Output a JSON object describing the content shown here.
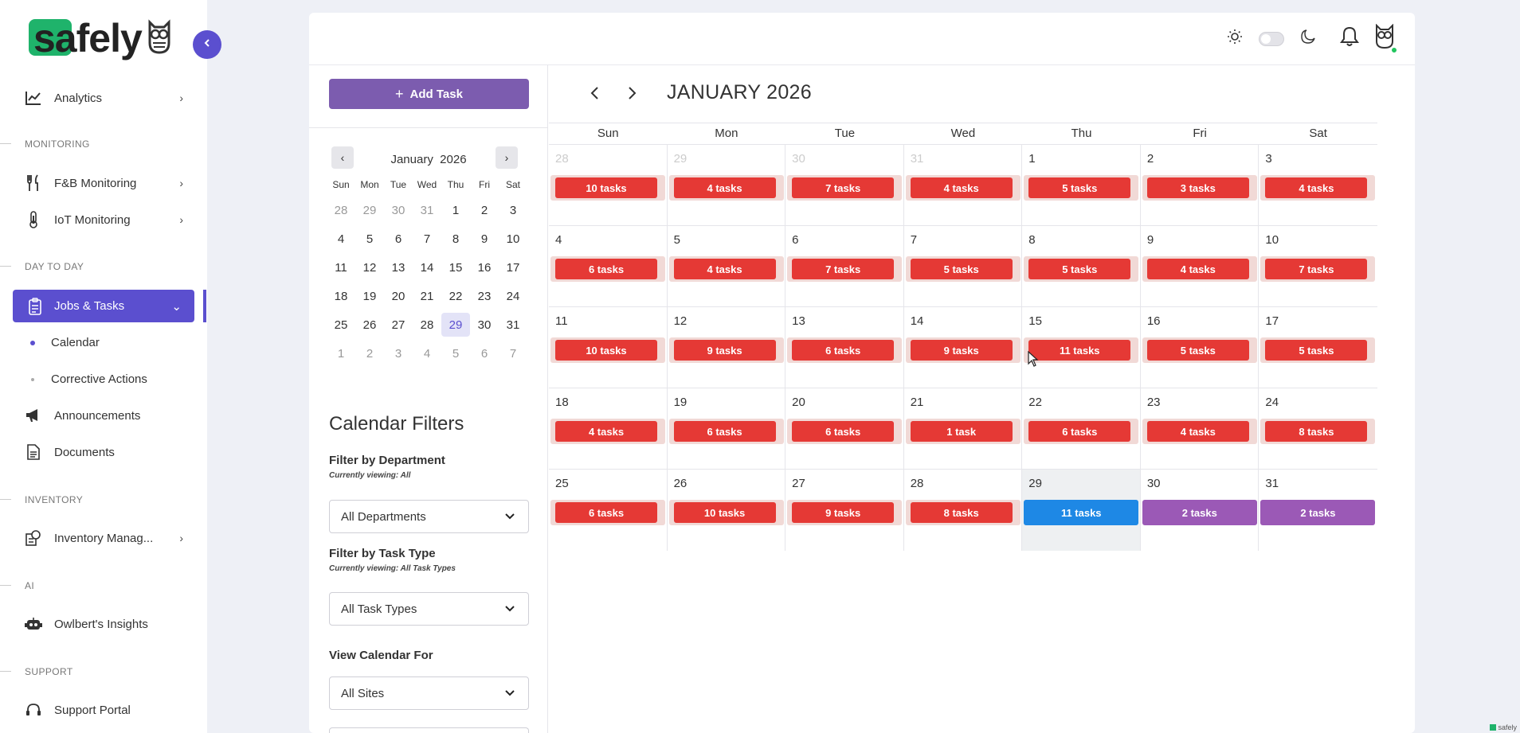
{
  "brand": {
    "name": "safely"
  },
  "sidebar": {
    "analytics": "Analytics",
    "sections": {
      "monitoring": "MONITORING",
      "day_to_day": "DAY TO DAY",
      "inventory": "INVENTORY",
      "ai": "AI",
      "support": "SUPPORT"
    },
    "items": {
      "fb": "F&B Monitoring",
      "iot": "IoT Monitoring",
      "jobs": "Jobs & Tasks",
      "calendar": "Calendar",
      "corrective": "Corrective Actions",
      "announcements": "Announcements",
      "documents": "Documents",
      "inventory": "Inventory Manag...",
      "insights": "Owlbert's Insights",
      "support": "Support Portal"
    },
    "accent": "#5b4fcf"
  },
  "left_panel": {
    "add_task": "Add Task",
    "mini_calendar": {
      "month": "January",
      "year": "2026",
      "weekdays": [
        "Sun",
        "Mon",
        "Tue",
        "Wed",
        "Thu",
        "Fri",
        "Sat"
      ],
      "weeks": [
        [
          "28",
          "29",
          "30",
          "31",
          "1",
          "2",
          "3"
        ],
        [
          "4",
          "5",
          "6",
          "7",
          "8",
          "9",
          "10"
        ],
        [
          "11",
          "12",
          "13",
          "14",
          "15",
          "16",
          "17"
        ],
        [
          "18",
          "19",
          "20",
          "21",
          "22",
          "23",
          "24"
        ],
        [
          "25",
          "26",
          "27",
          "28",
          "29",
          "30",
          "31"
        ],
        [
          "1",
          "2",
          "3",
          "4",
          "5",
          "6",
          "7"
        ]
      ]
    },
    "filters": {
      "title": "Calendar Filters",
      "department_label": "Filter by Department",
      "department_note": "Currently viewing: All",
      "department_value": "All Departments",
      "task_type_label": "Filter by Task Type",
      "task_type_note": "Currently viewing: All Task Types",
      "task_type_value": "All Task Types",
      "view_for_label": "View Calendar For",
      "view_for_value": "All Sites"
    }
  },
  "calendar": {
    "title": "JANUARY 2026",
    "weekdays": [
      "Sun",
      "Mon",
      "Tue",
      "Wed",
      "Thu",
      "Fri",
      "Sat"
    ],
    "weeks": [
      [
        [
          "28",
          "10 tasks"
        ],
        [
          "29",
          "4 tasks"
        ],
        [
          "30",
          "7 tasks"
        ],
        [
          "31",
          "4 tasks"
        ],
        [
          "1",
          "5 tasks"
        ],
        [
          "2",
          "3 tasks"
        ],
        [
          "3",
          "4 tasks"
        ]
      ],
      [
        [
          "4",
          "6 tasks"
        ],
        [
          "5",
          "4 tasks"
        ],
        [
          "6",
          "7 tasks"
        ],
        [
          "7",
          "5 tasks"
        ],
        [
          "8",
          "5 tasks"
        ],
        [
          "9",
          "4 tasks"
        ],
        [
          "10",
          "7 tasks"
        ]
      ],
      [
        [
          "11",
          "10 tasks"
        ],
        [
          "12",
          "9 tasks"
        ],
        [
          "13",
          "6 tasks"
        ],
        [
          "14",
          "9 tasks"
        ],
        [
          "15",
          "11 tasks"
        ],
        [
          "16",
          "5 tasks"
        ],
        [
          "17",
          "5 tasks"
        ]
      ],
      [
        [
          "18",
          "4 tasks"
        ],
        [
          "19",
          "6 tasks"
        ],
        [
          "20",
          "6 tasks"
        ],
        [
          "21",
          "1 task"
        ],
        [
          "22",
          "6 tasks"
        ],
        [
          "23",
          "4 tasks"
        ],
        [
          "24",
          "8 tasks"
        ]
      ],
      [
        [
          "25",
          "6 tasks"
        ],
        [
          "26",
          "10 tasks"
        ],
        [
          "27",
          "9 tasks"
        ],
        [
          "28",
          "8 tasks"
        ],
        [
          "29",
          "11 tasks"
        ],
        [
          "30",
          "2 tasks"
        ],
        [
          "31",
          "2 tasks"
        ]
      ]
    ],
    "colors": {
      "overdue": "#e53935",
      "today": "#1e88e5",
      "upcoming": "#9b59b6"
    }
  },
  "footer": {
    "mark": "safely"
  }
}
